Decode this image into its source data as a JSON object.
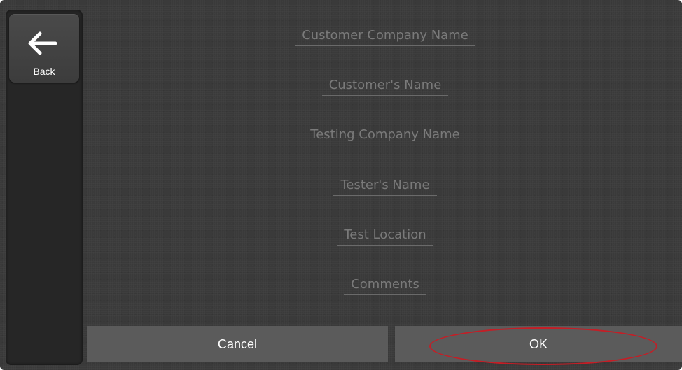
{
  "sidebar": {
    "back_button": {
      "icon": "arrow-left-icon",
      "label": "Back"
    }
  },
  "form": {
    "fields": [
      {
        "placeholder": "Customer Company Name"
      },
      {
        "placeholder": "Customer's Name"
      },
      {
        "placeholder": "Testing Company Name"
      },
      {
        "placeholder": "Tester's Name"
      },
      {
        "placeholder": "Test Location"
      },
      {
        "placeholder": "Comments"
      }
    ]
  },
  "actions": {
    "cancel_label": "Cancel",
    "ok_label": "OK"
  },
  "colors": {
    "background": "#3a3a3a",
    "sidebar": "#262626",
    "button": "#5b5b5b",
    "placeholder_text": "#7a7a7a",
    "highlight": "#c41e26"
  }
}
